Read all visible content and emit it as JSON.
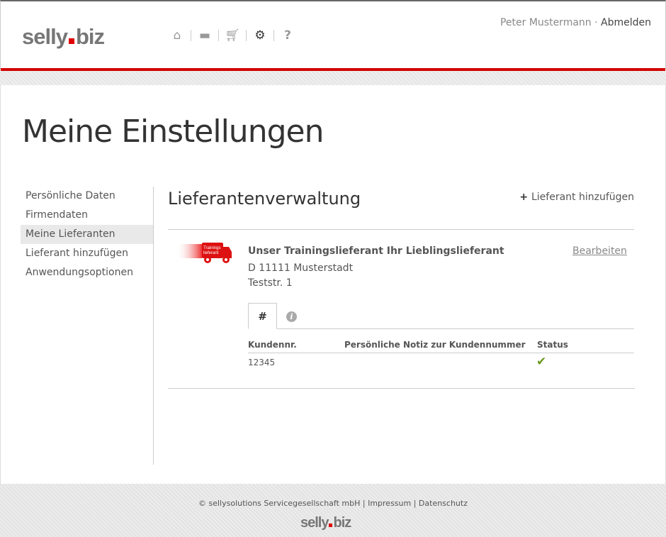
{
  "header": {
    "logo": "selly.biz",
    "logo_left": "selly",
    "logo_right": "biz",
    "nav_icons": [
      "home-icon",
      "chat-icon",
      "cart-icon",
      "gear-icon",
      "help-icon"
    ],
    "user_name": "Peter Mustermann",
    "separator": " · ",
    "logout": "Abmelden"
  },
  "page": {
    "title": "Meine Einstellungen"
  },
  "sidebar": {
    "items": [
      {
        "label": "Persönliche Daten"
      },
      {
        "label": "Firmendaten"
      },
      {
        "label": "Meine Lieferanten",
        "active": true
      },
      {
        "label": "Lieferant hinzufügen"
      },
      {
        "label": "Anwendungsoptionen"
      }
    ]
  },
  "main": {
    "title": "Lieferantenverwaltung",
    "add_label": "Lieferant hinzufügen",
    "supplier": {
      "logo_text": "Trainings lieferant",
      "name": "Unser Trainingslieferant Ihr Lieblingslieferant",
      "city": "D 11111 Musterstadt",
      "street": "Teststr. 1",
      "edit_label": "Bearbeiten",
      "tabs": [
        {
          "label": "#"
        },
        {
          "label": "i"
        }
      ],
      "columns": [
        "Kundennr.",
        "Persönliche Notiz zur Kundennummer",
        "Status"
      ],
      "rows": [
        {
          "customer_no": "12345",
          "note": "",
          "status": "✔"
        }
      ]
    }
  },
  "footer": {
    "copyright": "© sellysolutions Servicegesellschaft mbH",
    "impressum": "Impressum",
    "datenschutz": "Datenschutz",
    "sep": " | ",
    "logo_left": "selly",
    "logo_right": "biz"
  },
  "colors": {
    "accent": "#d40000",
    "check": "#6a9a1f"
  }
}
